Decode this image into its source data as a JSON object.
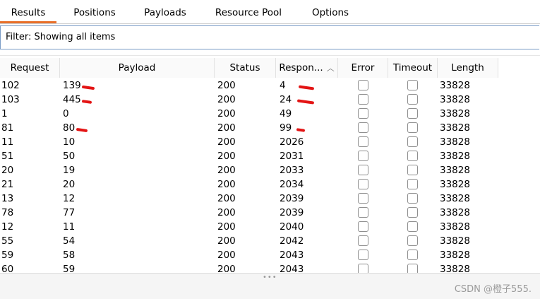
{
  "tabs": [
    {
      "label": "Results",
      "active": true
    },
    {
      "label": "Positions",
      "active": false
    },
    {
      "label": "Payloads",
      "active": false
    },
    {
      "label": "Resource Pool",
      "active": false
    },
    {
      "label": "Options",
      "active": false
    }
  ],
  "filter": {
    "text": "Filter: Showing all items"
  },
  "table": {
    "columns": [
      "Request",
      "Payload",
      "Status",
      "Respon...",
      "Error",
      "Timeout",
      "Length"
    ],
    "sort_icon": "sort-ascending-icon",
    "rows": [
      {
        "request": "102",
        "payload": "139",
        "status": "200",
        "response": "4",
        "error": false,
        "timeout": false,
        "length": "33828"
      },
      {
        "request": "103",
        "payload": "445",
        "status": "200",
        "response": "24",
        "error": false,
        "timeout": false,
        "length": "33828"
      },
      {
        "request": "1",
        "payload": "0",
        "status": "200",
        "response": "49",
        "error": false,
        "timeout": false,
        "length": "33828"
      },
      {
        "request": "81",
        "payload": "80",
        "status": "200",
        "response": "99",
        "error": false,
        "timeout": false,
        "length": "33828"
      },
      {
        "request": "11",
        "payload": "10",
        "status": "200",
        "response": "2026",
        "error": false,
        "timeout": false,
        "length": "33828"
      },
      {
        "request": "51",
        "payload": "50",
        "status": "200",
        "response": "2031",
        "error": false,
        "timeout": false,
        "length": "33828"
      },
      {
        "request": "20",
        "payload": "19",
        "status": "200",
        "response": "2033",
        "error": false,
        "timeout": false,
        "length": "33828"
      },
      {
        "request": "21",
        "payload": "20",
        "status": "200",
        "response": "2034",
        "error": false,
        "timeout": false,
        "length": "33828"
      },
      {
        "request": "13",
        "payload": "12",
        "status": "200",
        "response": "2039",
        "error": false,
        "timeout": false,
        "length": "33828"
      },
      {
        "request": "78",
        "payload": "77",
        "status": "200",
        "response": "2039",
        "error": false,
        "timeout": false,
        "length": "33828"
      },
      {
        "request": "12",
        "payload": "11",
        "status": "200",
        "response": "2040",
        "error": false,
        "timeout": false,
        "length": "33828"
      },
      {
        "request": "55",
        "payload": "54",
        "status": "200",
        "response": "2042",
        "error": false,
        "timeout": false,
        "length": "33828"
      },
      {
        "request": "59",
        "payload": "58",
        "status": "200",
        "response": "2043",
        "error": false,
        "timeout": false,
        "length": "33828"
      },
      {
        "request": "60",
        "payload": "59",
        "status": "200",
        "response": "2043",
        "error": false,
        "timeout": false,
        "length": "33828"
      }
    ]
  },
  "annotation_color": "#e31414",
  "watermark": "CSDN @橙子555."
}
